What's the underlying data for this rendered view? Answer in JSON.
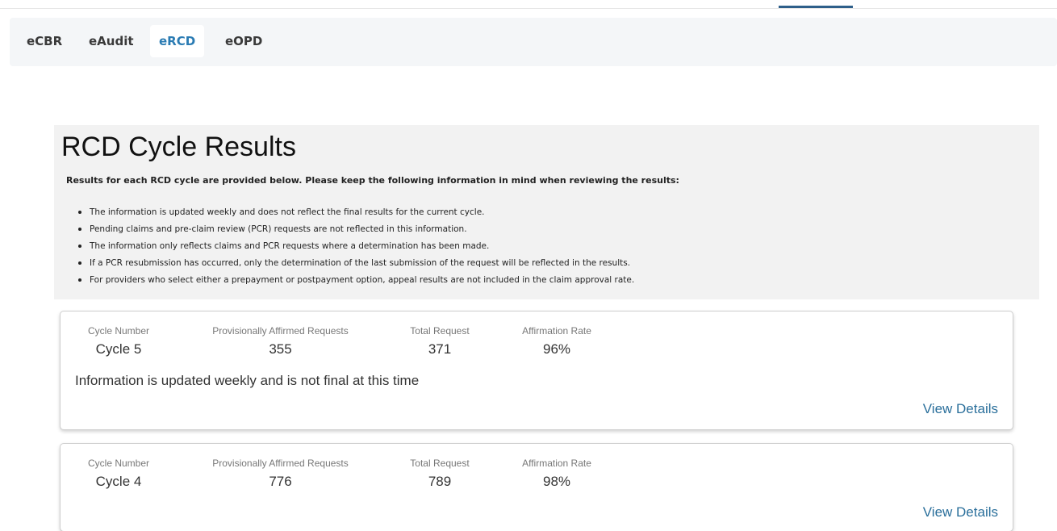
{
  "tabs": [
    {
      "label": "eCBR",
      "active": false
    },
    {
      "label": "eAudit",
      "active": false
    },
    {
      "label": "eRCD",
      "active": true
    },
    {
      "label": "eOPD",
      "active": false
    }
  ],
  "results": {
    "title": "RCD Cycle Results",
    "intro": "Results for each RCD cycle are provided below. Please keep the following information in mind when reviewing the results:",
    "bullets": [
      "The information is updated weekly and does not reflect the final results for the current cycle.",
      "Pending claims and pre-claim review (PCR) requests are not reflected in this information.",
      "The information only reflects claims and PCR requests where a determination has been made.",
      "If a PCR resubmission has occurred, only the determination of the last submission of the request will be reflected in the results.",
      "For providers who select either a prepayment or postpayment option, appeal results are not included in the claim approval rate."
    ]
  },
  "columns": {
    "cycle_number": "Cycle Number",
    "affirmed": "Provisionally Affirmed Requests",
    "total": "Total Request",
    "rate": "Affirmation Rate"
  },
  "cycles": [
    {
      "cycle": "Cycle 5",
      "affirmed": "355",
      "total": "371",
      "rate": "96%",
      "note": "Information is updated weekly and is not final at this time",
      "link": "View Details"
    },
    {
      "cycle": "Cycle 4",
      "affirmed": "776",
      "total": "789",
      "rate": "98%",
      "note": "",
      "link": "View Details"
    }
  ],
  "colors": {
    "accent": "#2a7bb3",
    "link": "#2a6f9b",
    "section_bg": "#f2f2f2",
    "tabbar_bg": "#f4f6f8"
  }
}
